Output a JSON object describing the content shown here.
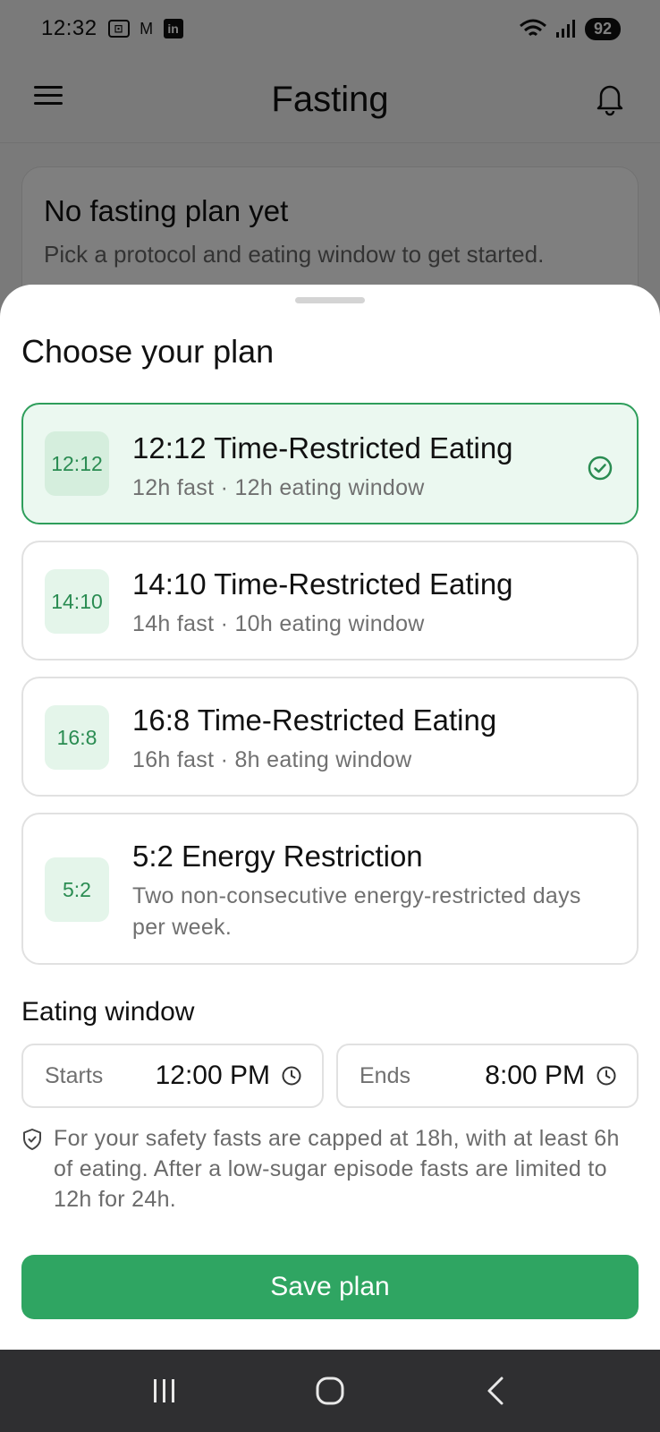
{
  "status_bar": {
    "time": "12:32",
    "battery": "92"
  },
  "app_bar": {
    "title": "Fasting"
  },
  "background_card": {
    "title": "No fasting plan yet",
    "text": "Pick a protocol and eating window to get started."
  },
  "sheet": {
    "title": "Choose your plan",
    "plans": [
      {
        "badge": "12:12",
        "name": "12:12 Time-Restricted Eating",
        "desc": "12h fast · 12h eating window",
        "selected": true
      },
      {
        "badge": "14:10",
        "name": "14:10 Time-Restricted Eating",
        "desc": "14h fast · 10h eating window",
        "selected": false
      },
      {
        "badge": "16:8",
        "name": "16:8 Time-Restricted Eating",
        "desc": "16h fast · 8h eating window",
        "selected": false
      },
      {
        "badge": "5:2",
        "name": "5:2 Energy Restriction",
        "desc": "Two non-consecutive energy-restricted days per week.",
        "selected": false
      }
    ],
    "eating_window": {
      "label": "Eating window",
      "start_label": "Starts",
      "start_value": "12:00 PM",
      "end_label": "Ends",
      "end_value": "8:00 PM"
    },
    "safety_note": "For your safety fasts are capped at 18h, with at least 6h of eating. After a low-sugar episode fasts are limited to 12h for 24h.",
    "save_label": "Save plan"
  },
  "colors": {
    "accent": "#2fa562",
    "selected_border": "#2e9e5b",
    "selected_bg": "#ebf8f0"
  }
}
